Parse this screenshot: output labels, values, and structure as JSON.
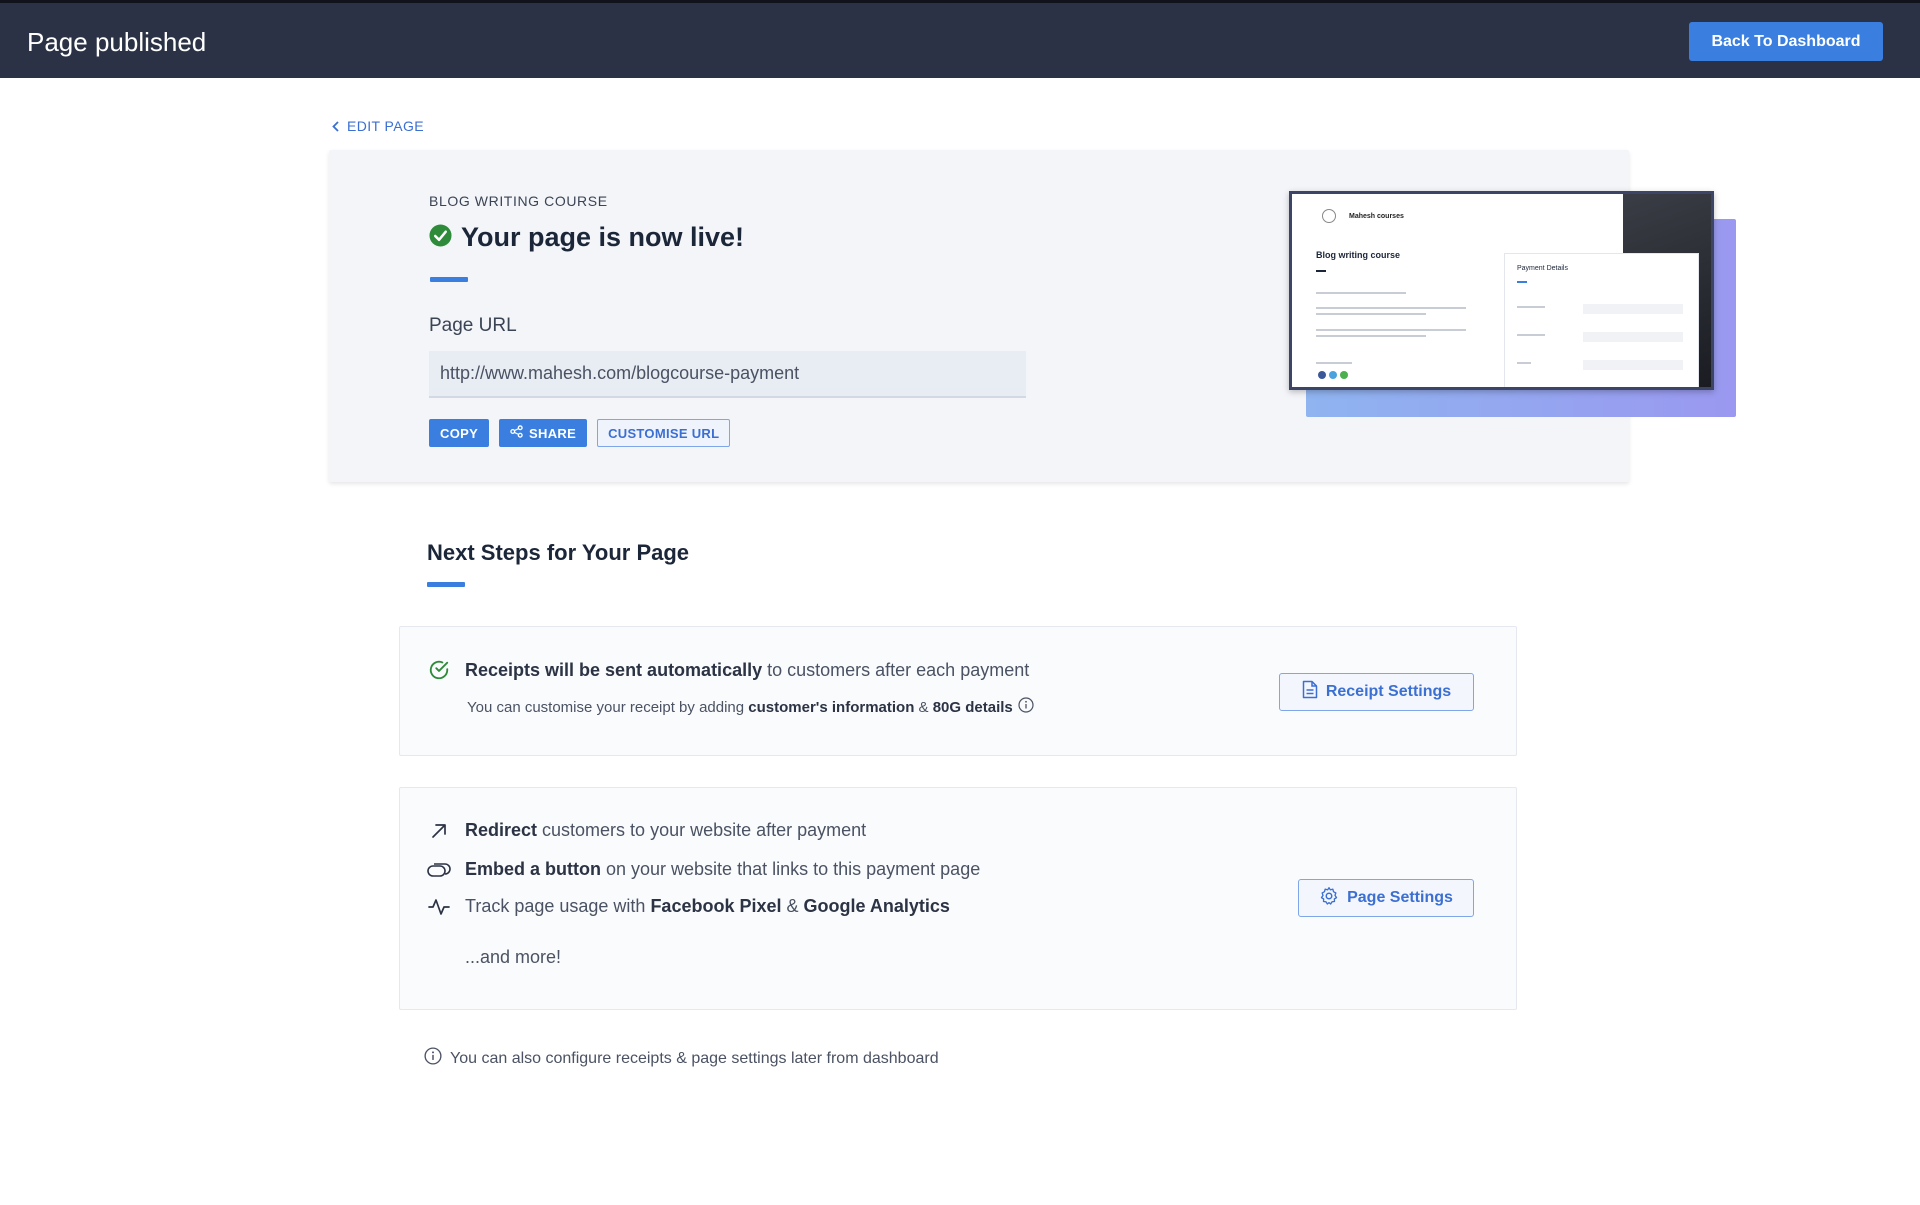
{
  "header": {
    "title": "Page published",
    "back_button": "Back To Dashboard"
  },
  "edit_link": "EDIT PAGE",
  "hero": {
    "course_name": "BLOG WRITING COURSE",
    "status": "Your page is now live!",
    "url_label": "Page URL",
    "url_value": "http://www.mahesh.com/blogcourse-payment",
    "actions": {
      "copy": "COPY",
      "share": "SHARE",
      "customise": "CUSTOMISE URL"
    }
  },
  "preview": {
    "brand": "Mahesh courses",
    "title": "Blog writing course",
    "payment_header": "Payment Details"
  },
  "next_steps": {
    "title": "Next Steps for Your Page",
    "receipts": {
      "bold": "Receipts will be sent automatically",
      "rest": " to customers after each payment",
      "sub_prefix": "You can customise your receipt by adding ",
      "sub_bold1": "customer's information",
      "sub_mid": " & ",
      "sub_bold2": "80G details",
      "button": "Receipt Settings"
    },
    "redirect": {
      "bold": "Redirect",
      "rest": " customers to your website after payment"
    },
    "embed": {
      "bold": "Embed a button",
      "rest": " on your website that links to this payment page"
    },
    "track": {
      "prefix": "Track page usage with ",
      "bold1": "Facebook Pixel",
      "mid": " & ",
      "bold2": "Google Analytics"
    },
    "more": "...and more!",
    "page_button": "Page Settings"
  },
  "footnote": "You can also configure receipts & page settings later from dashboard",
  "colors": {
    "header_bg": "#2b3246",
    "accent": "#3a7fe0",
    "success": "#2e8b3a"
  }
}
